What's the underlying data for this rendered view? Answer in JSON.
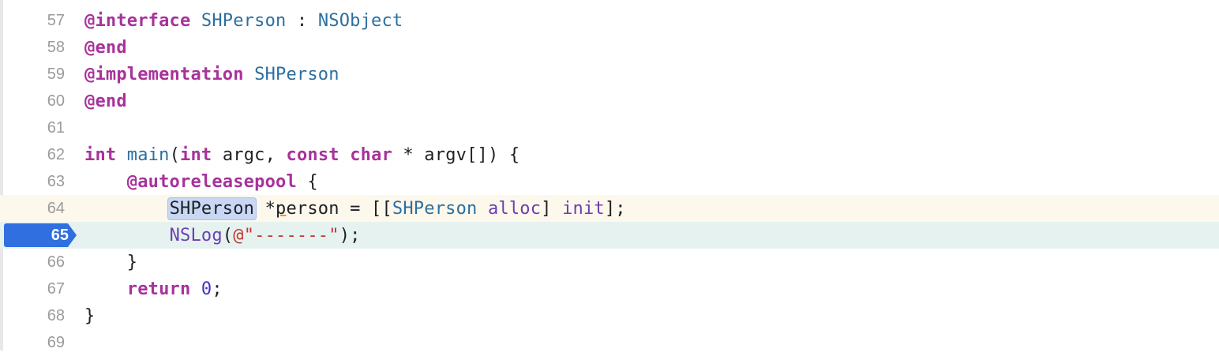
{
  "editor": {
    "lines": [
      {
        "num": "57",
        "tokens": [
          "@interface",
          " ",
          "SHPerson",
          " : ",
          "NSObject"
        ]
      },
      {
        "num": "58",
        "tokens": [
          "@end"
        ]
      },
      {
        "num": "59",
        "tokens": [
          "@implementation",
          " ",
          "SHPerson"
        ]
      },
      {
        "num": "60",
        "tokens": [
          "@end"
        ]
      },
      {
        "num": "61",
        "tokens": []
      },
      {
        "num": "62",
        "tokens": [
          "int",
          " ",
          "main",
          "(",
          "int",
          " argc, ",
          "const",
          " ",
          "char",
          " * argv[]) {"
        ]
      },
      {
        "num": "63",
        "tokens": [
          "    ",
          "@autoreleasepool",
          " {"
        ]
      },
      {
        "num": "64",
        "tokens": [
          "        ",
          "SHPerson",
          " *",
          "p",
          "erson = [[",
          "SHPerson",
          " ",
          "alloc",
          "] ",
          "init",
          "];"
        ]
      },
      {
        "num": "65",
        "tokens": [
          "        ",
          "NSLog",
          "(",
          "@\"-------\"",
          ");"
        ]
      },
      {
        "num": "66",
        "tokens": [
          "    }"
        ]
      },
      {
        "num": "67",
        "tokens": [
          "    ",
          "return",
          " ",
          "0",
          ";"
        ]
      },
      {
        "num": "68",
        "tokens": [
          "}"
        ]
      },
      {
        "num": "69",
        "tokens": []
      }
    ],
    "breakpoint_line": "65",
    "colors": {
      "keyword": "#a8329b",
      "type": "#2b6fa1",
      "framework_call": "#6b3fb0",
      "string": "#c2372f",
      "number": "#3b33c8",
      "breakpoint": "#2f6fe0",
      "current_line_bg": "#e6f2f0",
      "cursor_line_bg": "#fdf8ec"
    }
  }
}
